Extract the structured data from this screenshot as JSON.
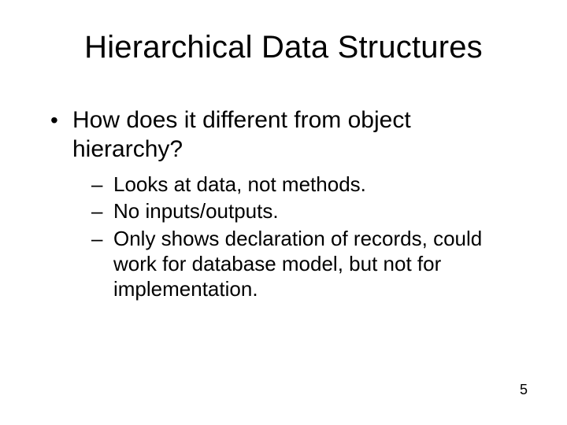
{
  "title": "Hierarchical Data Structures",
  "bullets": {
    "level1": [
      {
        "text": "How does it different from object hierarchy?",
        "children": [
          "Looks at data, not methods.",
          "No inputs/outputs.",
          "Only shows declaration of records, could work for database model, but not for implementation."
        ]
      }
    ]
  },
  "page_number": "5"
}
